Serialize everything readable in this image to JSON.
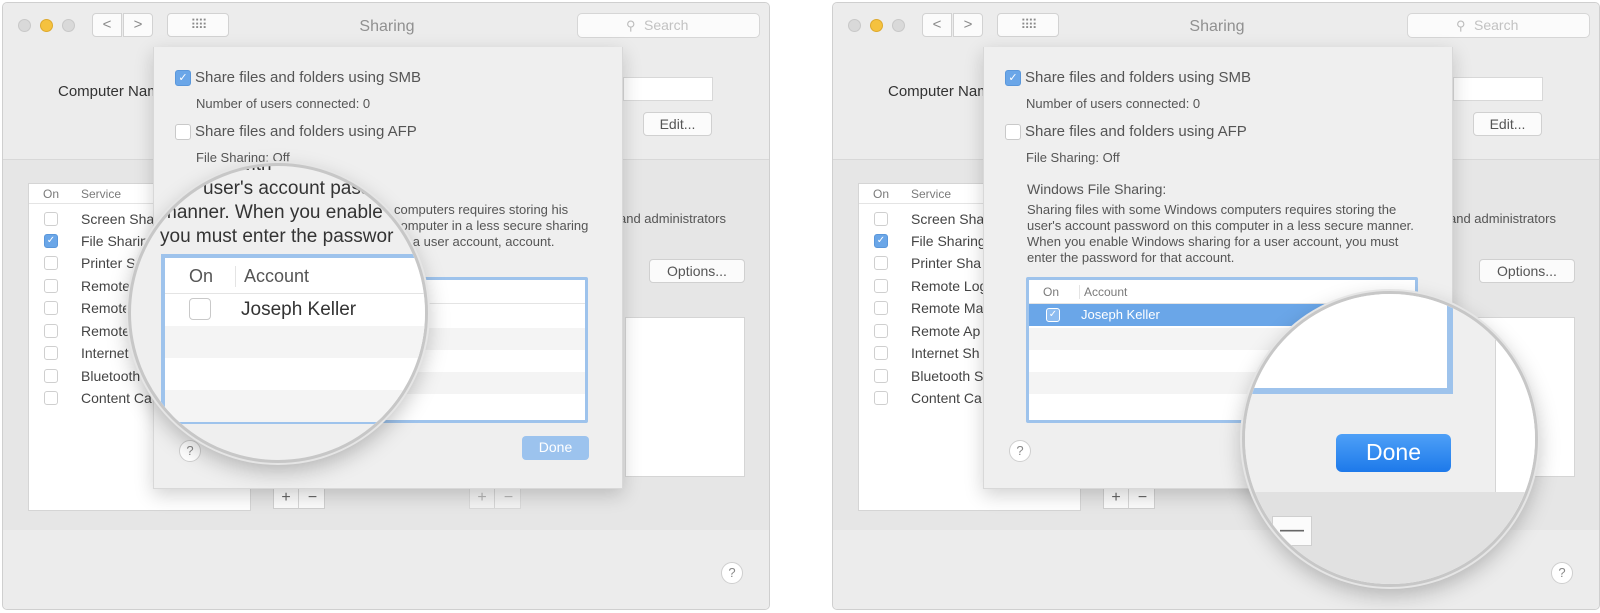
{
  "window": {
    "title": "Sharing",
    "search_placeholder": "Search",
    "nav_back": "<",
    "nav_forward": ">",
    "grid": "⠿⠿"
  },
  "computer_name": {
    "label": "Computer Nam",
    "edit_label": "Edit..."
  },
  "services": {
    "header_on": "On",
    "header_service": "Service",
    "items": [
      {
        "label": "Screen Sha",
        "on": false
      },
      {
        "label": "File Sharin",
        "on": true
      },
      {
        "label": "Printer Sh",
        "on": false
      },
      {
        "label": "Remote",
        "on": false
      },
      {
        "label": "Remote",
        "on": false
      },
      {
        "label": "Remote",
        "on": false
      },
      {
        "label": "Internet",
        "on": false
      },
      {
        "label": "Bluetooth",
        "on": false
      },
      {
        "label": "Content Ca",
        "on": false
      }
    ]
  },
  "services_right": {
    "items": [
      {
        "label": "Screen Sha"
      },
      {
        "label": "File Sharing"
      },
      {
        "label": "Printer Sha"
      },
      {
        "label": "Remote Log"
      },
      {
        "label": "Remote Ma"
      },
      {
        "label": "Remote Ap"
      },
      {
        "label": "Internet Sh"
      },
      {
        "label": "Bluetooth S"
      },
      {
        "label": "Content Ca"
      }
    ]
  },
  "main": {
    "admin_text": "and administrators",
    "options_label": "Options...",
    "plus": "+",
    "minus": "−",
    "help": "?"
  },
  "sheet": {
    "smb_label": "Share files and folders using SMB",
    "smb_checked": true,
    "users_connected": "Number of users connected: 0",
    "afp_label": "Share files and folders using AFP",
    "afp_checked": false,
    "file_sharing_status": "File Sharing: Off",
    "windows_heading": "Windows File Sharing:",
    "windows_para": "Sharing files with some Windows computers requires storing the user's account password on this computer in a less secure manner.  When you enable Windows sharing for a user account, you must enter the password for that account.",
    "left_para_visible": "computers requires storing his computer in a less secure sharing for a user account, account.",
    "table_on": "On",
    "table_account": "Account",
    "account_name": "Joseph Keller",
    "done_label": "Done",
    "help": "?"
  },
  "magnifier_left": {
    "line1": "s with",
    "line2": "user's account pass",
    "line3": "manner.  When you enable",
    "line4": "you must enter the passwor",
    "table_on": "On",
    "table_account": "Account",
    "account_name": "Joseph Keller",
    "account_checked": false
  },
  "magnifier_right": {
    "done_label": "Done",
    "minus": "—"
  },
  "colors": {
    "accent": "#6aa6e8",
    "selection": "#6aa6e8",
    "done_disabled": "#9cc3ee",
    "done_active": "#1d79ea"
  }
}
